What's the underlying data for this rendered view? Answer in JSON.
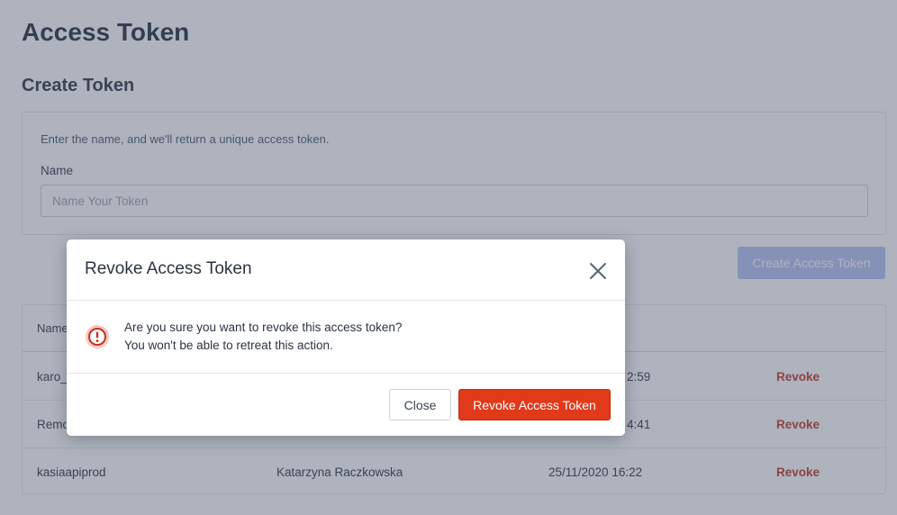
{
  "page": {
    "title": "Access Token",
    "section_title": "Create Token"
  },
  "create_form": {
    "description": "Enter the name, and we'll return a unique access token.",
    "name_label": "Name",
    "name_placeholder": "Name Your Token",
    "name_value": "",
    "submit_label": "Create Access Token"
  },
  "tokens_table": {
    "columns": [
      "Name",
      "",
      "",
      ""
    ],
    "rows": [
      {
        "name": "karo_",
        "created_by": "",
        "date": "2:59",
        "action": "Revoke"
      },
      {
        "name": "Remo",
        "created_by": "",
        "date": "4:41",
        "action": "Revoke"
      },
      {
        "name": "kasiaapiprod",
        "created_by": "Katarzyna Raczkowska",
        "date": "25/11/2020 16:22",
        "action": "Revoke"
      }
    ]
  },
  "modal": {
    "title": "Revoke Access Token",
    "message_line1": "Are you sure you want to revoke this access token?",
    "message_line2": "You won't be able to retreat this action.",
    "close_label": "Close",
    "confirm_label": "Revoke Access Token",
    "icons": {
      "close": "close-icon",
      "warning": "warning-icon"
    }
  },
  "colors": {
    "accent_disabled": "#b6c1f2",
    "danger": "#e03a1a",
    "danger_text": "#c4321e",
    "overlay": "rgba(75,87,110,0.45)"
  }
}
